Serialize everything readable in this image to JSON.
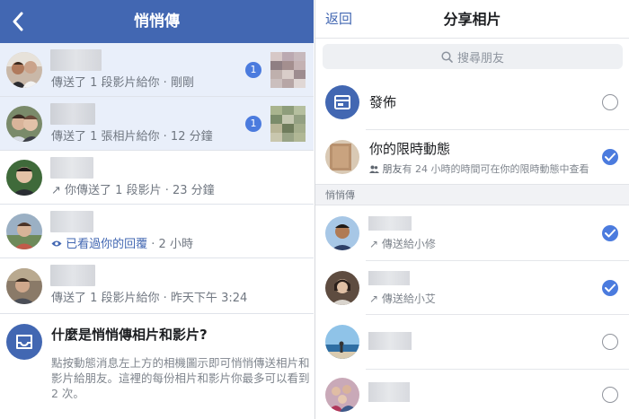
{
  "left": {
    "header_title": "悄悄傳",
    "conversations": [
      {
        "subtitle": "傳送了 1 段影片給你 · 剛剛",
        "badge": "1",
        "unread": true
      },
      {
        "subtitle": "傳送了 1 張相片給你 · 12 分鐘",
        "badge": "1",
        "unread": true
      },
      {
        "subtitle_prefix": "↗",
        "subtitle": "你傳送了 1 段影片 · 23 分鐘",
        "unread": false
      },
      {
        "subtitle_prefix": "👁",
        "seen_text": "已看過你的回覆",
        "subtitle": " · 2 小時",
        "unread": false
      },
      {
        "subtitle": "傳送了 1 段影片給你 · 昨天下午 3:24",
        "unread": false
      }
    ],
    "info": {
      "title": "什麼是悄悄傳相片和影片?",
      "body": "點按動態消息左上方的相機圖示即可悄悄傳送相片和影片給朋友。這裡的每份相片和影片你最多可以看到 2 次。"
    }
  },
  "right": {
    "back_label": "返回",
    "title": "分享相片",
    "search_placeholder": "搜尋朋友",
    "post_label": "發佈",
    "story_label": "你的限時動態",
    "story_audience": "朋友",
    "story_sub": "有 24 小時的時間可在你的限時動態中查看",
    "section_label": "悄悄傳",
    "recipients": [
      {
        "send_text": "傳送給小修",
        "checked": true
      },
      {
        "send_text": "傳送給小艾",
        "checked": true
      },
      {
        "send_text": "",
        "checked": false
      },
      {
        "send_text": "",
        "checked": false
      }
    ]
  },
  "colors": {
    "brand_blue": "#4267b2",
    "check_blue": "#4b7bde",
    "unread_bg": "#e9effa"
  },
  "icons": [
    "back-chevron-icon",
    "search-icon",
    "post-icon",
    "check-icon",
    "arrow-sent-icon",
    "eye-icon",
    "friends-icon",
    "inbox-icon"
  ]
}
